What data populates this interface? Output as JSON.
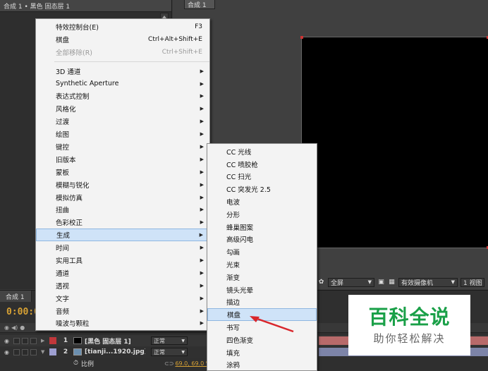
{
  "effect_panel": {
    "title": "合成 1 • 黑色 固态层 1"
  },
  "comp_viewer": {
    "tab": "合成 1",
    "toolbar": {
      "magnification": "全屏",
      "camera": "有效摄像机",
      "views": "1 视图"
    }
  },
  "timeline": {
    "tab": "合成 1",
    "timecode": "0:00:0",
    "layers": [
      {
        "num": "1",
        "name": "[黑色 固态层 1]",
        "mode": "正常",
        "label_color": "#c0373b"
      },
      {
        "num": "2",
        "name": "[tianji...1920.jpg]",
        "mode": "正常",
        "label_color": "#9d9fd1"
      }
    ],
    "property": {
      "name": "比例",
      "value": "69.0, 69.0 %"
    }
  },
  "main_menu": {
    "items": [
      {
        "label": "特效控制台(E)",
        "shortcut": "F3"
      },
      {
        "label": "棋盘",
        "shortcut": "Ctrl+Alt+Shift+E"
      },
      {
        "label": "全部移除(R)",
        "shortcut": "Ctrl+Shift+E",
        "disabled": true
      }
    ],
    "categories": [
      "3D 通道",
      "Synthetic Aperture",
      "表达式控制",
      "风格化",
      "过渡",
      "绘图",
      "键控",
      "旧版本",
      "蒙板",
      "模糊与锐化",
      "模拟仿真",
      "扭曲",
      "色彩校正",
      "生成",
      "时间",
      "实用工具",
      "通道",
      "透视",
      "文字",
      "音频",
      "噪波与颗粒"
    ],
    "highlighted": "生成"
  },
  "sub_menu": {
    "items": [
      "CC 光线",
      "CC 喷胶枪",
      "CC 扫光",
      "CC 突发光 2.5",
      "电波",
      "分形",
      "蜂巢图案",
      "高级闪电",
      "勾画",
      "光束",
      "渐变",
      "镜头光晕",
      "描边",
      "棋盘",
      "书写",
      "四色渐变",
      "填充",
      "涂鸦"
    ],
    "highlighted": "棋盘"
  },
  "watermark": {
    "title": "百科全说",
    "subtitle": "助你轻松解决"
  },
  "colors": {
    "accent_orange": "#d8a234",
    "menu_highlight": "#cfe3f8",
    "annotation_arrow": "#d9262b",
    "watermark_green": "#1aa048"
  }
}
